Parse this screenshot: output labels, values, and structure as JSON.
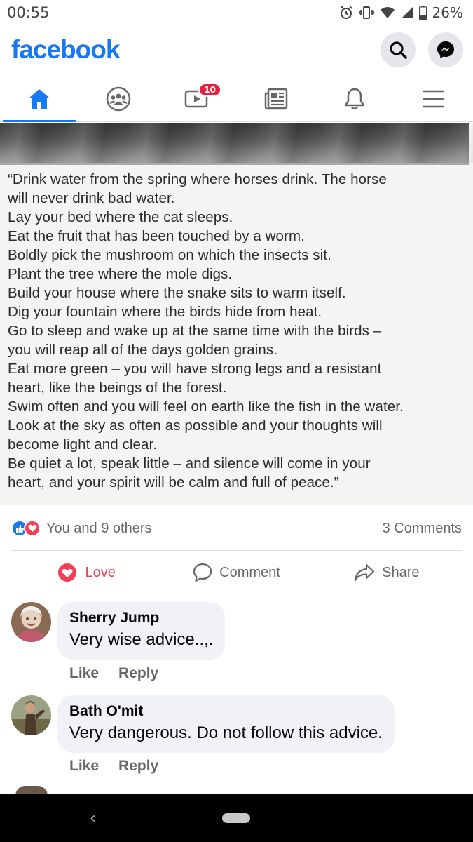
{
  "status_bar": {
    "time": "00:55",
    "battery": "26%",
    "icons": [
      "alarm-icon",
      "vibrate-icon",
      "wifi-icon",
      "signal-icon",
      "battery-icon"
    ]
  },
  "header": {
    "logo": "facebook",
    "buttons": [
      "search-icon",
      "messenger-icon"
    ]
  },
  "tabs": [
    {
      "icon": "home-icon",
      "active": true
    },
    {
      "icon": "groups-icon",
      "active": false
    },
    {
      "icon": "watch-icon",
      "active": false,
      "badge": "10"
    },
    {
      "icon": "news-icon",
      "active": false
    },
    {
      "icon": "bell-icon",
      "active": false
    },
    {
      "icon": "menu-icon",
      "active": false
    }
  ],
  "post": {
    "quote_lines": [
      "“Drink water from the spring where horses drink. The horse",
      "will never drink bad water.",
      "Lay your bed where the cat sleeps.",
      "Eat the fruit that has been touched by a worm.",
      "Boldly pick the mushroom on which the insects sit.",
      "Plant the tree where the mole digs.",
      "Build your house where the snake sits to warm itself.",
      "Dig your fountain where the birds hide from heat.",
      "Go to sleep and wake up at the same time with the birds –",
      "you will reap all of the days golden grains.",
      "Eat more green – you will have strong legs and a resistant",
      "heart, like the beings of the forest.",
      "Swim often and you will feel on earth like the fish in the water.",
      "Look at the sky as often as possible and your thoughts will",
      "become light and clear.",
      "Be quiet a lot, speak little – and silence will come in your",
      "heart, and your spirit will be calm and full of peace.”"
    ],
    "reactions_text": "You and 9 others",
    "comments_count": "3 Comments",
    "actions": {
      "love": "Love",
      "comment": "Comment",
      "share": "Share"
    }
  },
  "comments": [
    {
      "name": "Sherry Jump",
      "text": "Very wise advice..,.",
      "like": "Like",
      "reply": "Reply"
    },
    {
      "name": "Bath O'mit",
      "text": "Very dangerous. Do not follow this advice.",
      "like": "Like",
      "reply": "Reply"
    }
  ],
  "colors": {
    "brand": "#1877f2",
    "love": "#f33e58",
    "badge": "#e41e3f"
  }
}
